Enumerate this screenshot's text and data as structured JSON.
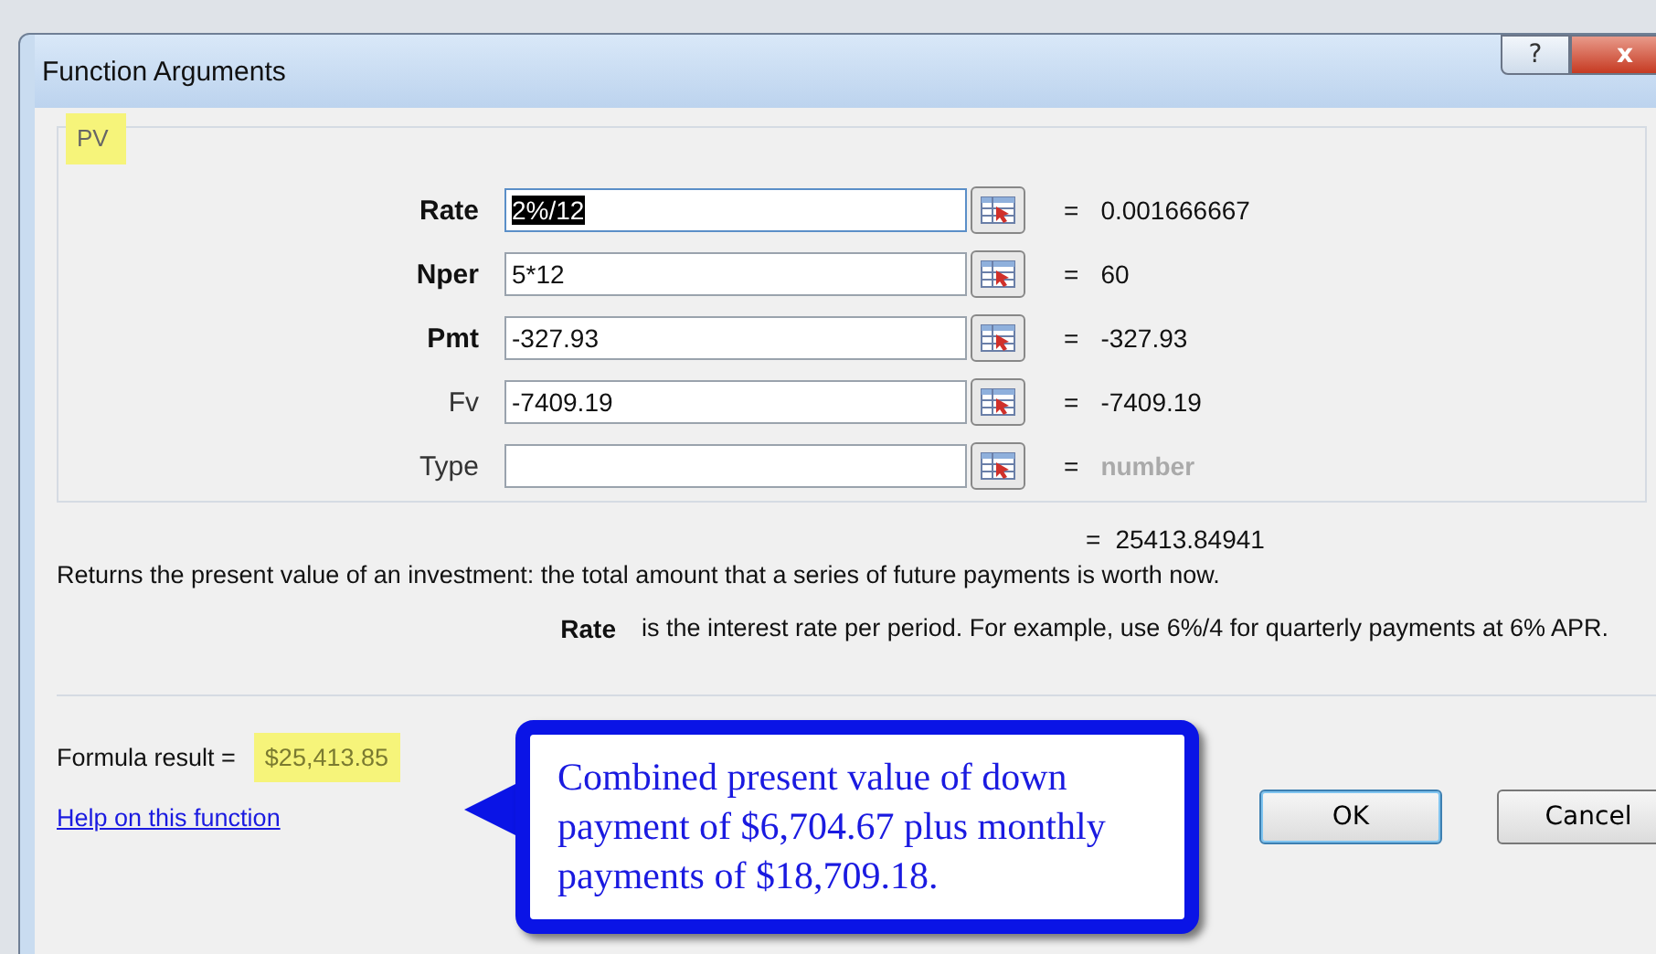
{
  "window": {
    "title": "Function Arguments",
    "buttons": [
      {
        "kind": "help",
        "label": "?"
      },
      {
        "kind": "close",
        "label": "x"
      }
    ]
  },
  "function_name": "PV",
  "equals_sign": "=",
  "arguments": [
    {
      "label": "Rate",
      "required": true,
      "value": "2%/12",
      "selected": true,
      "result": "0.001666667",
      "result_muted": false
    },
    {
      "label": "Nper",
      "required": true,
      "value": "5*12",
      "selected": false,
      "result": "60",
      "result_muted": false
    },
    {
      "label": "Pmt",
      "required": true,
      "value": "-327.93",
      "selected": false,
      "result": "-327.93",
      "result_muted": false
    },
    {
      "label": "Fv",
      "required": false,
      "value": "-7409.19",
      "selected": false,
      "result": "-7409.19",
      "result_muted": false
    },
    {
      "label": "Type",
      "required": false,
      "selected": false,
      "result": "number",
      "result_muted": true
    }
  ],
  "overall_result": {
    "sign": "=",
    "value": "25413.84941"
  },
  "description": "Returns the present value of an investment: the total amount that a series of future payments is worth now.",
  "argument_help": {
    "name": "Rate",
    "text": "is the interest rate per period. For example, use 6%/4 for quarterly payments at 6% APR."
  },
  "formula_result": {
    "label": "Formula result =",
    "value": "$25,413.85"
  },
  "help_link": "Help on this function",
  "buttons": [
    {
      "label": "OK",
      "default": true
    },
    {
      "label": "Cancel",
      "default": false
    }
  ],
  "callout": "Combined present value of down payment of $6,704.67 plus monthly payments of $18,709.18."
}
